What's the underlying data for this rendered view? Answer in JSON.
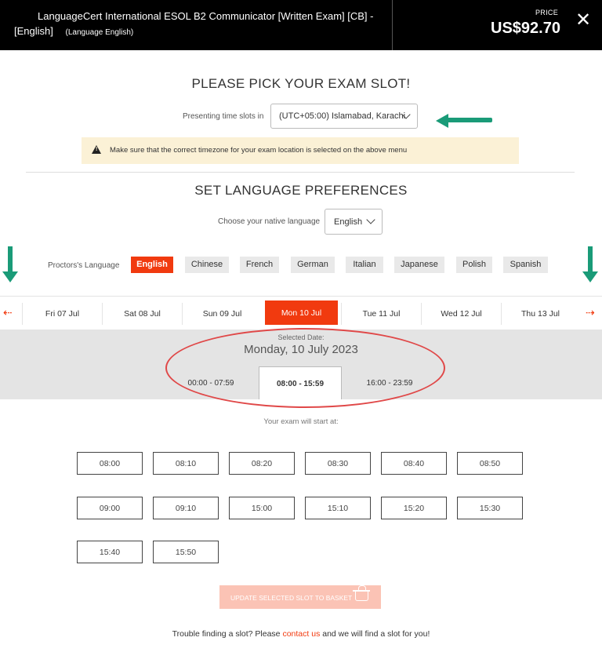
{
  "header": {
    "title_line1": "LanguageCert International ESOL B2 Communicator [Written Exam] [CB] -",
    "title_line2": "[English]",
    "title_sub": "(Language English)",
    "price_label": "PRICE",
    "price": "US$92.70",
    "close_icon": "✕"
  },
  "exam_slot": {
    "heading": "PLEASE PICK YOUR EXAM SLOT!",
    "timezone_label": "Presenting time slots in",
    "timezone_value": "(UTC+05:00) Islamabad, Karachi",
    "warning": "Make sure that the correct timezone for your exam location is selected on the above menu"
  },
  "language_prefs": {
    "heading": "SET LANGUAGE PREFERENCES",
    "native_label": "Choose your native language",
    "native_value": "English",
    "proctor_label": "Proctors's Language",
    "proctor_options": [
      "English",
      "Chinese",
      "French",
      "German",
      "Italian",
      "Japanese",
      "Polish",
      "Spanish"
    ],
    "proctor_selected": "English"
  },
  "dates": {
    "days": [
      "Fri 07 Jul",
      "Sat 08 Jul",
      "Sun 09 Jul",
      "Mon 10 Jul",
      "Tue 11 Jul",
      "Wed 12 Jul",
      "Thu 13 Jul"
    ],
    "selected_day": "Mon 10 Jul",
    "prev_arrow": "⇠",
    "next_arrow": "⇢"
  },
  "selected": {
    "caption": "Selected Date:",
    "date": "Monday, 10 July 2023",
    "ranges": [
      "00:00 - 07:59",
      "08:00 - 15:59",
      "16:00 - 23:59"
    ],
    "active_range": "08:00 - 15:59"
  },
  "slots": {
    "label": "Your exam will start at:",
    "times": [
      "08:00",
      "08:10",
      "08:20",
      "08:30",
      "08:40",
      "08:50",
      "09:00",
      "09:10",
      "15:00",
      "15:10",
      "15:20",
      "15:30",
      "15:40",
      "15:50"
    ]
  },
  "update_button": "UPDATE SELECTED SLOT TO BASKET",
  "footer": {
    "prefix": "Trouble finding a slot? Please",
    "link": "contact us",
    "suffix": "and we will find a slot for you!"
  },
  "colors": {
    "accent": "#f13a0f",
    "annotation_arrow": "#1a9b78",
    "annotation_circle": "#e04848"
  }
}
